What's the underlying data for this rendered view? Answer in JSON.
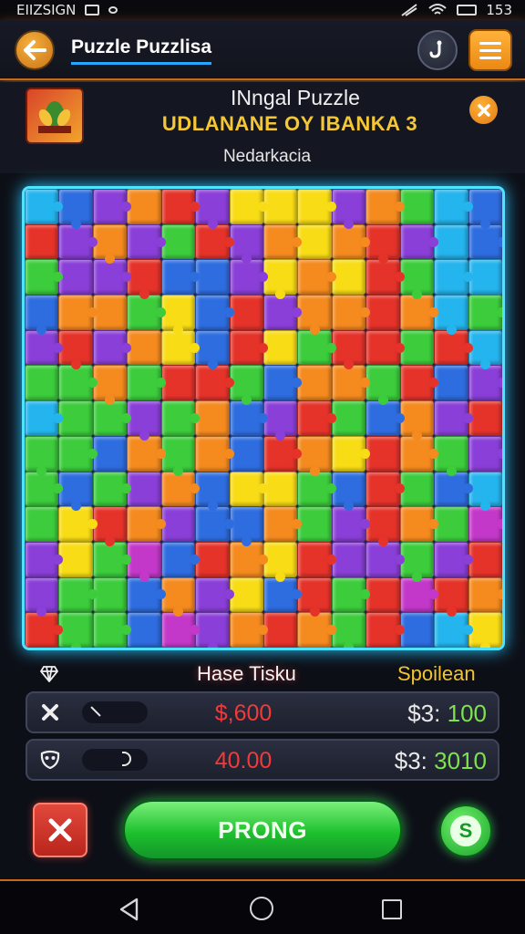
{
  "status_bar": {
    "left_text": "EIIZSIGN",
    "right_text": "153"
  },
  "top_bar": {
    "title": "Puzzle Puzzlisa"
  },
  "header": {
    "name": "INngal Puzzle",
    "subtitle": "UDLANANE OY IBANKA 3",
    "description": "Nedarkacia"
  },
  "board": {
    "palette": {
      "R": "#e5332a",
      "O": "#f58a1f",
      "Y": "#f8dc16",
      "G": "#3ccc3c",
      "B": "#2e6de0",
      "C": "#24b4ee",
      "P": "#8a3fd8",
      "M": "#c338c9"
    },
    "pattern": [
      "CBPORPYYYPOGCB",
      "RPOPGRPOYORPCB",
      "GPPRBBPYOYRGCC",
      "BOOGYBRPOOROCG",
      "PRPOYBRYGRRGRC",
      "GGOGRRGBOOGRBP",
      "CGGPGOBPRGBOPR",
      "GGBOGOBROYROGP",
      "GBGPOBYYGBRGBC",
      "GYROPBBOGPROGM",
      "PYGMBROYRPPGPR",
      "PGGBOPYBRGRMRO",
      "RGGBMPOROGRBCY"
    ]
  },
  "stats": {
    "title": "Hase Tisku",
    "side_label": "Spoilean",
    "rows": [
      {
        "value": "$,600",
        "currency": "$3:",
        "amount": "100"
      },
      {
        "value": "40.00",
        "currency": "$3:",
        "amount": "3010"
      }
    ]
  },
  "actions": {
    "primary_label": "PRONG",
    "coin_symbol": "S"
  },
  "icons": {
    "back": "arrow-left-icon",
    "hint": "lightbulb-icon",
    "menu": "hamburger-menu-icon",
    "close": "close-icon",
    "diamond": "diamond-icon",
    "row1": "x-icon",
    "row2": "mask-icon",
    "cancel": "cancel-icon",
    "coin": "coin-icon"
  },
  "colors": {
    "accent_orange": "#f59a1f",
    "board_glow": "#4fe3ff",
    "primary_green": "#2ec23e",
    "danger_red": "#e23a30"
  }
}
